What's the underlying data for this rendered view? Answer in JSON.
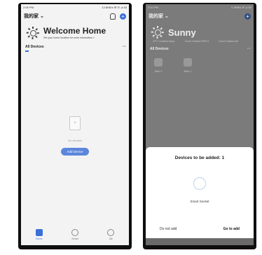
{
  "left": {
    "status": {
      "time": "2:05 PM",
      "right": "12.6KB/s ☰ ☷ ⊿ 83"
    },
    "home_name": "我的家 ⌄",
    "welcome_title": "Welcome Home",
    "welcome_sub": "Set your home location for more information >",
    "section_title": "All Devices",
    "more": "···",
    "empty_text": "No devices",
    "add_device": "Add Device",
    "tabs": [
      {
        "label": "Home"
      },
      {
        "label": "Smart"
      },
      {
        "label": "Me"
      }
    ]
  },
  "right": {
    "status": {
      "time": "2:10 PM",
      "right": "0.3KB/s ☰ ⊿ 83"
    },
    "home_name": "我的家 ⌄",
    "weather": "Sunny",
    "wx": [
      "22°C Outdoor temp.",
      "Good Outdoor PM2.5",
      "Good Outdoor Air"
    ],
    "section_title": "All Devices",
    "more": "···",
    "devices": [
      "Mini 2",
      "Mini 1"
    ],
    "sheet_title": "Devices to be added: 1",
    "device_name": "Smart Socket",
    "do_not_add": "Do not add",
    "go_to_add": "Go to add"
  },
  "colors": {
    "accent": "#3a6fd8",
    "button": "#5b86db"
  }
}
